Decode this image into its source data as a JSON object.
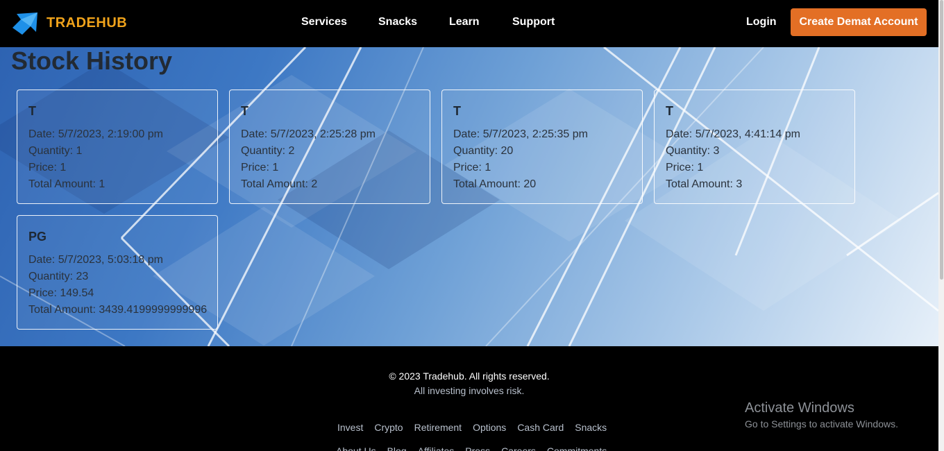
{
  "header": {
    "brand": "TRADEHUB",
    "nav": [
      "Services",
      "Snacks",
      "Learn",
      "Support"
    ],
    "login": "Login",
    "cta": "Create Demat Account"
  },
  "page": {
    "title": "Stock History"
  },
  "cards": [
    {
      "symbol": "T",
      "date": "Date: 5/7/2023, 2:19:00 pm",
      "quantity": "Quantity: 1",
      "price": "Price: 1",
      "total": "Total Amount: 1"
    },
    {
      "symbol": "T",
      "date": "Date: 5/7/2023, 2:25:28 pm",
      "quantity": "Quantity: 2",
      "price": "Price: 1",
      "total": "Total Amount: 2"
    },
    {
      "symbol": "T",
      "date": "Date: 5/7/2023, 2:25:35 pm",
      "quantity": "Quantity: 20",
      "price": "Price: 1",
      "total": "Total Amount: 20"
    },
    {
      "symbol": "T",
      "date": "Date: 5/7/2023, 4:41:14 pm",
      "quantity": "Quantity: 3",
      "price": "Price: 1",
      "total": "Total Amount: 3"
    },
    {
      "symbol": "PG",
      "date": "Date: 5/7/2023, 5:03:18 pm",
      "quantity": "Quantity: 23",
      "price": "Price: 149.54",
      "total": "Total Amount: 3439.4199999999996"
    }
  ],
  "footer": {
    "copyright": "© 2023 Tradehub. All rights reserved.",
    "risk": "All investing involves risk.",
    "links": [
      "Invest",
      "Crypto",
      "Retirement",
      "Options",
      "Cash Card",
      "Snacks"
    ],
    "links2": [
      "About Us",
      "Blog",
      "Affiliates",
      "Press",
      "Careers",
      "Commitments"
    ]
  },
  "watermark": {
    "title": "Activate Windows",
    "subtitle": "Go to Settings to activate Windows."
  },
  "colors": {
    "brand": "#f0a31b",
    "cta": "#e36f25"
  }
}
